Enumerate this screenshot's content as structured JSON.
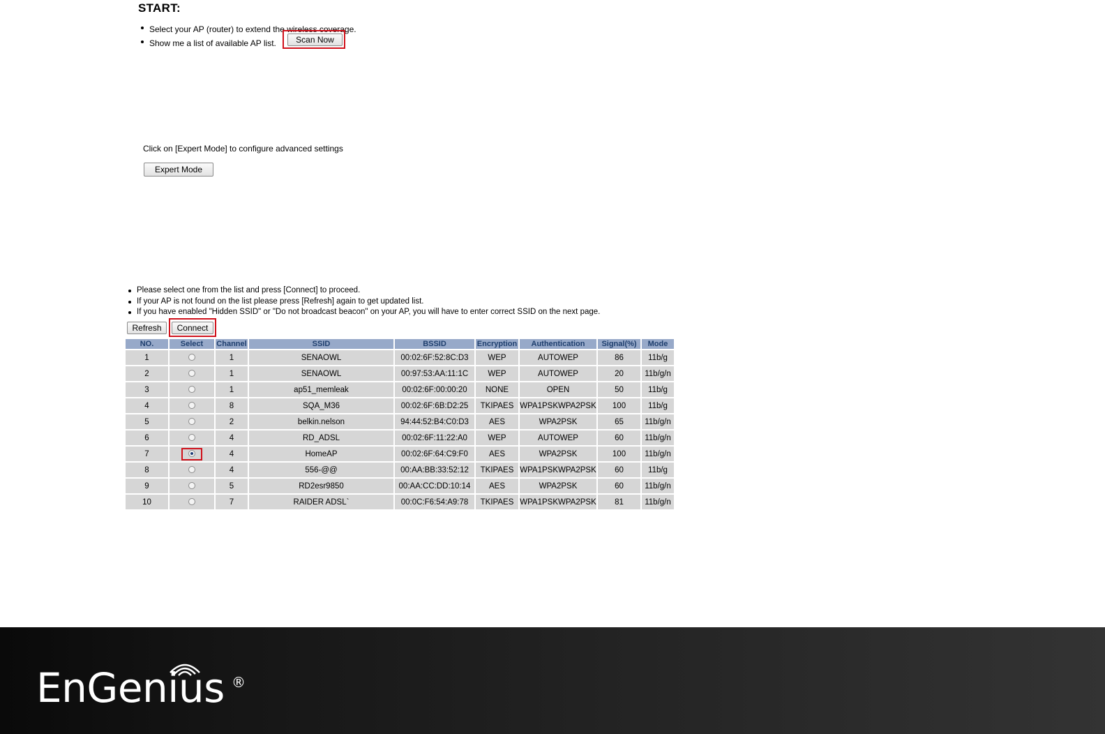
{
  "start": {
    "title": "START:",
    "bullets": [
      "Select your AP (router) to extend the wireless coverage.",
      "Show me a list of available AP list."
    ],
    "scan_button": "Scan Now"
  },
  "expert": {
    "text": "Click on [Expert Mode] to configure advanced settings",
    "button": "Expert Mode"
  },
  "ap_list": {
    "notes": [
      "Please select one from the list and press [Connect] to proceed.",
      "If your AP is not found on the list please press [Refresh] again to get updated list.",
      "If you have enabled \"Hidden SSID\" or \"Do not broadcast beacon\" on your AP, you will have to enter correct SSID on the next page."
    ],
    "refresh_button": "Refresh",
    "connect_button": "Connect",
    "columns": [
      "NO.",
      "Select",
      "Channel",
      "SSID",
      "BSSID",
      "Encryption",
      "Authentication",
      "Signal(%)",
      "Mode"
    ],
    "rows": [
      {
        "no": "1",
        "selected": false,
        "channel": "1",
        "ssid": "SENAOWL",
        "bssid": "00:02:6F:52:8C:D3",
        "encryption": "WEP",
        "auth": "AUTOWEP",
        "signal": "86",
        "mode": "11b/g"
      },
      {
        "no": "2",
        "selected": false,
        "channel": "1",
        "ssid": "SENAOWL",
        "bssid": "00:97:53:AA:11:1C",
        "encryption": "WEP",
        "auth": "AUTOWEP",
        "signal": "20",
        "mode": "11b/g/n"
      },
      {
        "no": "3",
        "selected": false,
        "channel": "1",
        "ssid": "ap51_memleak",
        "bssid": "00:02:6F:00:00:20",
        "encryption": "NONE",
        "auth": "OPEN",
        "signal": "50",
        "mode": "11b/g"
      },
      {
        "no": "4",
        "selected": false,
        "channel": "8",
        "ssid": "SQA_M36",
        "bssid": "00:02:6F:6B:D2:25",
        "encryption": "TKIPAES",
        "auth": "WPA1PSKWPA2PSK",
        "signal": "100",
        "mode": "11b/g"
      },
      {
        "no": "5",
        "selected": false,
        "channel": "2",
        "ssid": "belkin.nelson",
        "bssid": "94:44:52:B4:C0:D3",
        "encryption": "AES",
        "auth": "WPA2PSK",
        "signal": "65",
        "mode": "11b/g/n"
      },
      {
        "no": "6",
        "selected": false,
        "channel": "4",
        "ssid": "RD_ADSL",
        "bssid": "00:02:6F:11:22:A0",
        "encryption": "WEP",
        "auth": "AUTOWEP",
        "signal": "60",
        "mode": "11b/g/n"
      },
      {
        "no": "7",
        "selected": true,
        "channel": "4",
        "ssid": "HomeAP",
        "bssid": "00:02:6F:64:C9:F0",
        "encryption": "AES",
        "auth": "WPA2PSK",
        "signal": "100",
        "mode": "11b/g/n"
      },
      {
        "no": "8",
        "selected": false,
        "channel": "4",
        "ssid": "556-@@",
        "bssid": "00:AA:BB:33:52:12",
        "encryption": "TKIPAES",
        "auth": "WPA1PSKWPA2PSK",
        "signal": "60",
        "mode": "11b/g"
      },
      {
        "no": "9",
        "selected": false,
        "channel": "5",
        "ssid": "RD2esr9850",
        "bssid": "00:AA:CC:DD:10:14",
        "encryption": "AES",
        "auth": "WPA2PSK",
        "signal": "60",
        "mode": "11b/g/n"
      },
      {
        "no": "10",
        "selected": false,
        "channel": "7",
        "ssid": "RAIDER ADSL`",
        "bssid": "00:0C:F6:54:A9:78",
        "encryption": "TKIPAES",
        "auth": "WPA1PSKWPA2PSK",
        "signal": "81",
        "mode": "11b/g/n"
      }
    ]
  },
  "footer": {
    "logo_text": "EnGenius",
    "registered_mark": "®",
    "background": "#1c1c1c",
    "highlight_color": "#d0111b"
  }
}
